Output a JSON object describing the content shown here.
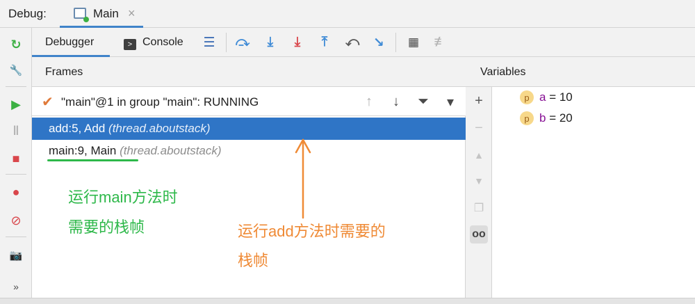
{
  "topbar": {
    "debug_label": "Debug:",
    "tab_label": "Main",
    "tab_close": "×"
  },
  "toolbar": {
    "debugger_tab": "Debugger",
    "console_tab": "Console",
    "console_icon_glyph": ">",
    "buttons": [
      {
        "name": "show-execution-point",
        "glyph": "☰",
        "color": "#3f6fb5"
      },
      {
        "name": "step-over",
        "glyph": "⤼",
        "color": "#3f8bd6"
      },
      {
        "name": "step-into",
        "glyph": "⤓",
        "color": "#3f8bd6"
      },
      {
        "name": "force-step-into",
        "glyph": "⤓",
        "color": "#d9464b"
      },
      {
        "name": "step-out",
        "glyph": "⤒",
        "color": "#3f8bd6"
      },
      {
        "name": "drop-frame",
        "glyph": "⤺",
        "color": "#5a5a5a"
      },
      {
        "name": "run-to-cursor",
        "glyph": "↘",
        "color": "#3f8bd6"
      },
      {
        "name": "evaluate-expression",
        "glyph": "▦",
        "color": "#4a4a4a"
      },
      {
        "name": "trace-current-stream",
        "glyph": "≢",
        "color": "#b4b4b4"
      }
    ]
  },
  "frames": {
    "header": "Frames",
    "thread": {
      "check_glyph": "✔",
      "label": "\"main\"@1 in group \"main\": RUNNING"
    },
    "thread_actions": [
      {
        "name": "up-arrow",
        "glyph": "↑",
        "color": "#b0b0b0"
      },
      {
        "name": "down-arrow",
        "glyph": "↓",
        "color": "#4a4a4a"
      },
      {
        "name": "filter",
        "glyph": "⏷",
        "color": "#4a4a4a"
      },
      {
        "name": "dropdown",
        "glyph": "▾",
        "color": "#4a4a4a"
      }
    ],
    "items": [
      {
        "method": "add:5, Add",
        "meta": "(thread.aboutstack)",
        "selected": true
      },
      {
        "method": "main:9, Main",
        "meta": "(thread.aboutstack)",
        "selected": false
      }
    ]
  },
  "variables": {
    "header": "Variables",
    "side_buttons": [
      {
        "name": "add",
        "glyph": "+",
        "state": "normal"
      },
      {
        "name": "remove",
        "glyph": "−",
        "state": "dis"
      },
      {
        "name": "move-up",
        "glyph": "▲",
        "state": "dis"
      },
      {
        "name": "move-down",
        "glyph": "▼",
        "state": "dis"
      },
      {
        "name": "copy",
        "glyph": "❐",
        "state": "dis"
      },
      {
        "name": "watches",
        "glyph": "oo",
        "state": "on"
      }
    ],
    "items": [
      {
        "badge": "p",
        "name": "a",
        "eq": " = ",
        "value": "10"
      },
      {
        "badge": "p",
        "name": "b",
        "eq": " = ",
        "value": "20"
      }
    ]
  },
  "leftbar": [
    {
      "name": "rerun",
      "glyph": "↻",
      "color": "#3cb043"
    },
    {
      "name": "settings-wrench",
      "glyph": "🔧",
      "color": "#5a5a5a"
    },
    {
      "name": "resume",
      "glyph": "▶",
      "color": "#3cb043"
    },
    {
      "name": "pause",
      "glyph": "‖",
      "color": "#b4b4b4"
    },
    {
      "name": "stop",
      "glyph": "■",
      "color": "#d9464b"
    },
    {
      "name": "view-breakpoints",
      "glyph": "●",
      "color": "#d9464b"
    },
    {
      "name": "mute-breakpoints",
      "glyph": "⊘",
      "color": "#d9464b"
    },
    {
      "name": "camera",
      "glyph": "📷",
      "color": "#4a4a4a"
    },
    {
      "name": "more",
      "glyph": "»",
      "color": "#4a4a4a"
    }
  ],
  "annotations": {
    "green_line1": "运行main方法时",
    "green_line2": "需要的栈帧",
    "orange_line1": "运行add方法时需要的",
    "orange_line2": "栈帧",
    "green_color": "#2eb84a",
    "orange_color": "#ef8a35"
  }
}
